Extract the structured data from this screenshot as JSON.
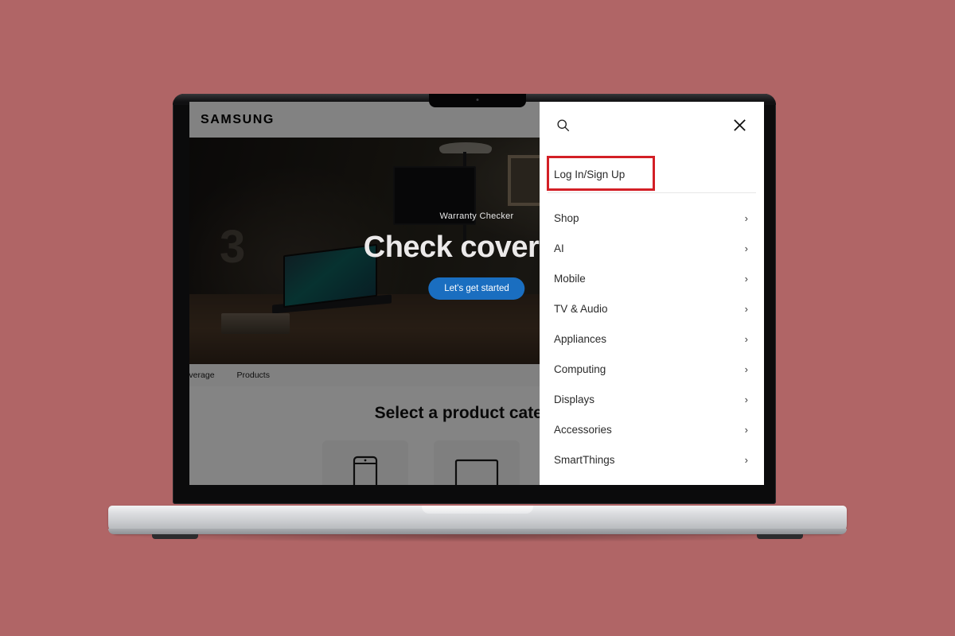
{
  "background_color": "#b06566",
  "device": {
    "type": "laptop-mockup",
    "notch": true
  },
  "site": {
    "brand": "SAMSUNG",
    "hero": {
      "eyebrow": "Warranty Checker",
      "title": "Check coverage",
      "cta_label": "Let's get started"
    },
    "subnav": {
      "items": [
        "Coverage",
        "Products"
      ]
    },
    "chooser": {
      "title": "Select a product category",
      "cards": [
        {
          "icon": "phone-icon",
          "label": ""
        },
        {
          "icon": "tv-icon",
          "label": ""
        },
        {
          "icon": "refrigerator-icon",
          "label": ""
        }
      ]
    }
  },
  "menu_panel": {
    "search_icon": "search-icon",
    "close_icon": "close-icon",
    "auth_label": "Log In/Sign Up",
    "highlight_color": "#d31f26",
    "items": [
      {
        "label": "Shop",
        "chevron": "›"
      },
      {
        "label": "AI",
        "chevron": "›"
      },
      {
        "label": "Mobile",
        "chevron": "›"
      },
      {
        "label": "TV & Audio",
        "chevron": "›"
      },
      {
        "label": "Appliances",
        "chevron": "›"
      },
      {
        "label": "Computing",
        "chevron": "›"
      },
      {
        "label": "Displays",
        "chevron": "›"
      },
      {
        "label": "Accessories",
        "chevron": "›"
      },
      {
        "label": "SmartThings",
        "chevron": "›"
      }
    ]
  }
}
